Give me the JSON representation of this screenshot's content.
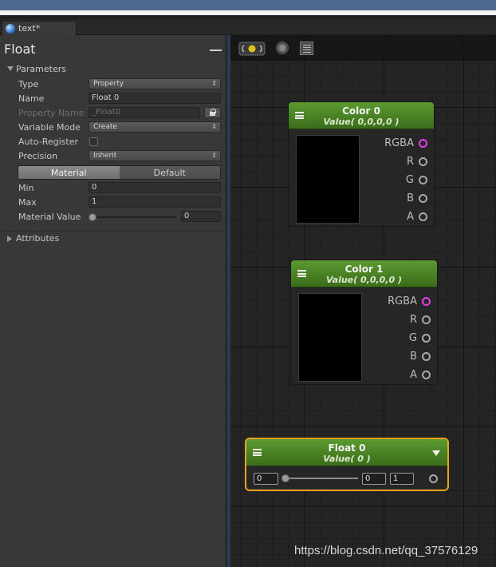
{
  "tab": {
    "title": "text*"
  },
  "panel": {
    "title": "Float",
    "parameters_label": "Parameters",
    "attributes_label": "Attributes",
    "type": {
      "label": "Type",
      "value": "Property"
    },
    "name": {
      "label": "Name",
      "value": "Float 0"
    },
    "property_name": {
      "label": "Property Name",
      "value": "_Float0"
    },
    "variable_mode": {
      "label": "Variable Mode",
      "value": "Create"
    },
    "auto_register": {
      "label": "Auto-Register",
      "checked": false
    },
    "precision": {
      "label": "Precision",
      "value": "Inherit"
    },
    "toggle": {
      "material": "Material",
      "default": "Default",
      "active": "material"
    },
    "min": {
      "label": "Min",
      "value": "0"
    },
    "max": {
      "label": "Max",
      "value": "1"
    },
    "material_value": {
      "label": "Material Value",
      "value": "0"
    }
  },
  "nodes": {
    "color0": {
      "title": "Color 0",
      "subtitle": "Value( 0,0,0,0 )",
      "ports": [
        "RGBA",
        "R",
        "G",
        "B",
        "A"
      ]
    },
    "color1": {
      "title": "Color 1",
      "subtitle": "Value( 0,0,0,0 )",
      "ports": [
        "RGBA",
        "R",
        "G",
        "B",
        "A"
      ]
    },
    "float0": {
      "title": "Float 0",
      "subtitle": "Value( 0 )",
      "value": "0",
      "min": "0",
      "max": "1"
    }
  },
  "colors": {
    "node_header": "#4e8a26",
    "selected_border": "#e8a21b",
    "rgba_port": "#e53de5"
  },
  "watermark": "https://blog.csdn.net/qq_37576129"
}
